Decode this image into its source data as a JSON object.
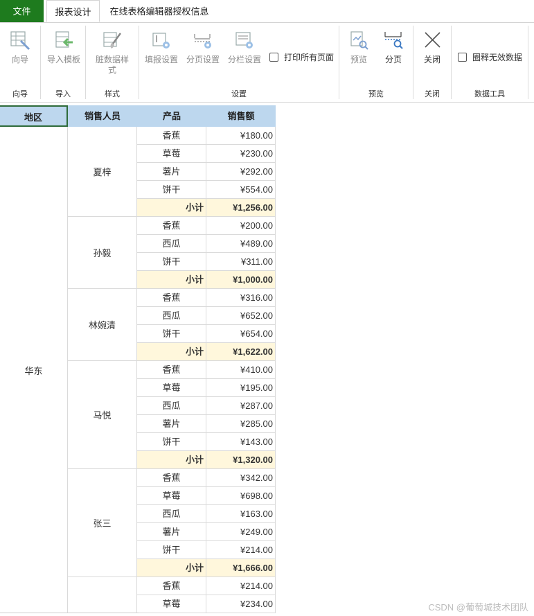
{
  "tabs": {
    "file": "文件",
    "report_design": "报表设计",
    "license_info": "在线表格编辑器授权信息"
  },
  "ribbon": {
    "groups": {
      "wizard": "向导",
      "import": "导入",
      "style": "样式",
      "settings": "设置",
      "preview": "预览",
      "close": "关闭",
      "data_tools": "数据工具"
    },
    "buttons": {
      "wizard": "向导",
      "import_template": "导入模板",
      "dirty_data_style": "脏数据样式",
      "fill_settings": "填报设置",
      "page_settings": "分页设置",
      "column_settings": "分栏设置",
      "preview": "预览",
      "paging": "分页",
      "close": "关闭"
    },
    "checkboxes": {
      "print_all": "打印所有页面",
      "circle_invalid": "圈释无效数据"
    }
  },
  "table": {
    "headers": {
      "region": "地区",
      "person": "销售人员",
      "product": "产品",
      "amount": "销售额"
    },
    "region": "华东",
    "subtotal_label": "小计",
    "groups": [
      {
        "person": "夏梓",
        "items": [
          {
            "product": "香蕉",
            "amount": "¥180.00"
          },
          {
            "product": "草莓",
            "amount": "¥230.00"
          },
          {
            "product": "薯片",
            "amount": "¥292.00"
          },
          {
            "product": "饼干",
            "amount": "¥554.00"
          }
        ],
        "subtotal": "¥1,256.00"
      },
      {
        "person": "孙毅",
        "items": [
          {
            "product": "香蕉",
            "amount": "¥200.00"
          },
          {
            "product": "西瓜",
            "amount": "¥489.00"
          },
          {
            "product": "饼干",
            "amount": "¥311.00"
          }
        ],
        "subtotal": "¥1,000.00"
      },
      {
        "person": "林婉清",
        "items": [
          {
            "product": "香蕉",
            "amount": "¥316.00"
          },
          {
            "product": "西瓜",
            "amount": "¥652.00"
          },
          {
            "product": "饼干",
            "amount": "¥654.00"
          }
        ],
        "subtotal": "¥1,622.00"
      },
      {
        "person": "马悦",
        "items": [
          {
            "product": "香蕉",
            "amount": "¥410.00"
          },
          {
            "product": "草莓",
            "amount": "¥195.00"
          },
          {
            "product": "西瓜",
            "amount": "¥287.00"
          },
          {
            "product": "薯片",
            "amount": "¥285.00"
          },
          {
            "product": "饼干",
            "amount": "¥143.00"
          }
        ],
        "subtotal": "¥1,320.00"
      },
      {
        "person": "张三",
        "items": [
          {
            "product": "香蕉",
            "amount": "¥342.00"
          },
          {
            "product": "草莓",
            "amount": "¥698.00"
          },
          {
            "product": "西瓜",
            "amount": "¥163.00"
          },
          {
            "product": "薯片",
            "amount": "¥249.00"
          },
          {
            "product": "饼干",
            "amount": "¥214.00"
          }
        ],
        "subtotal": "¥1,666.00"
      },
      {
        "person": "",
        "items": [
          {
            "product": "香蕉",
            "amount": "¥214.00"
          },
          {
            "product": "草莓",
            "amount": "¥234.00"
          }
        ],
        "subtotal": null
      }
    ]
  },
  "watermark": "CSDN @葡萄城技术团队",
  "colors": {
    "file_tab": "#1e7b1e",
    "header_bg": "#bdd7ee",
    "subtotal_bg": "#fff7dc",
    "selection_border": "#2e6b3a"
  }
}
